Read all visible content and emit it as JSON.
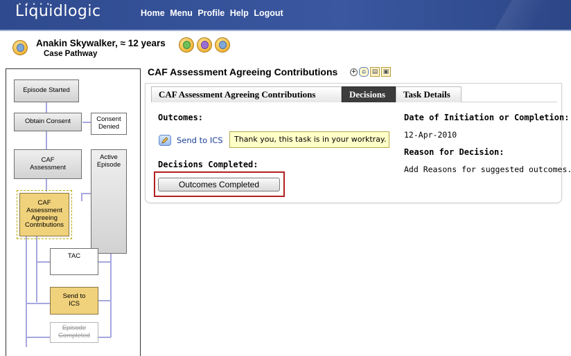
{
  "app": {
    "logo": "Liquidlogic",
    "nav": [
      "Home",
      "Menu",
      "Profile",
      "Help",
      "Logout"
    ]
  },
  "patient": {
    "name": "Anakin Skywalker, ≈ 12 years",
    "subtitle": "Case Pathway"
  },
  "pathway": {
    "nodes": {
      "episode_started": "Episode Started",
      "obtain_consent": "Obtain Consent",
      "consent_denied": "Consent Denied",
      "caf_assessment": "CAF Assessment",
      "active_episode": "Active Episode",
      "caf_agreeing": "CAF Assessment Agreeing Contributions",
      "tac": "TAC",
      "send_to_ics": "Send to ICS",
      "episode_completed": "Episode Completed"
    },
    "colors": {
      "selected": "#f0d27c",
      "grey": "#d9d9d9",
      "connector": "#a6a6e0"
    }
  },
  "main": {
    "title": "CAF Assessment Agreeing Contributions",
    "tabs": [
      "CAF Assessment Agreeing Contributions",
      "Decisions",
      "Task Details"
    ],
    "active_tab": "Decisions",
    "outcomes_label": "Outcomes:",
    "send_link": "Send to ICS",
    "notice": "Thank you, this task is in your worktray.",
    "decisions_label": "Decisions Completed:",
    "outcomes_button": "Outcomes Completed",
    "date_label": "Date of Initiation or Completion:",
    "date_value": "12-Apr-2010",
    "reason_label": "Reason for Decision:",
    "reason_value": "Add Reasons for suggested outcomes......"
  },
  "icons": [
    "user-icon",
    "family-icon",
    "case-icon",
    "add-icon",
    "home-icon",
    "document-icon",
    "print-icon",
    "pencil-icon"
  ]
}
